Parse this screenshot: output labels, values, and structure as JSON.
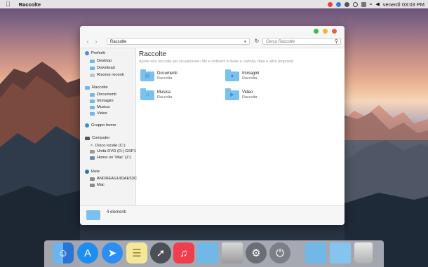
{
  "menubar": {
    "apple": "",
    "app_name": "Raccolte",
    "clock": "venerdì 03:03 PM"
  },
  "window": {
    "address_value": "Raccolte",
    "search_placeholder": "Cerca Raccolte",
    "sidebar": {
      "favorites": {
        "label": "Preferiti",
        "items": [
          "Desktop",
          "Download",
          "Risorse recenti"
        ]
      },
      "libraries": {
        "label": "Raccolte",
        "items": [
          "Documenti",
          "Immagini",
          "Musica",
          "Video"
        ]
      },
      "homegroup": {
        "label": "Gruppo home"
      },
      "computer": {
        "label": "Computer",
        "items": [
          "Disco locale (C:)",
          "Unità DVD (D:) GSP1",
          "Home on 'Mac' (Z:)"
        ]
      },
      "network": {
        "label": "Rete",
        "items": [
          "ANDREAGUIDAE53C",
          "Mac"
        ]
      }
    },
    "main": {
      "title": "Raccolte",
      "subtitle": "Aprire una raccolta per visualizzare i file e ordinarli in base a cartella, data e altre proprietà.",
      "libraries": [
        {
          "name": "Documenti",
          "kind": "Raccolta",
          "icon": "document-icon"
        },
        {
          "name": "Immagini",
          "kind": "Raccolta",
          "icon": "image-icon"
        },
        {
          "name": "Musica",
          "kind": "Raccolta",
          "icon": "music-icon"
        },
        {
          "name": "Video",
          "kind": "Raccolta",
          "icon": "video-icon"
        }
      ]
    },
    "status": {
      "count": "4 elementi"
    }
  },
  "colors": {
    "folder": "#79c1ef",
    "traffic_green": "#2ec43f",
    "traffic_yellow": "#f6b62a",
    "traffic_red": "#f25a4f"
  },
  "dock": {
    "items": [
      "finder-icon",
      "app-store-icon",
      "safari-icon",
      "notes-icon",
      "launchpad-icon",
      "music-icon",
      "folder-icon",
      "drive-icon",
      "settings-icon",
      "power-icon",
      "window-icon",
      "folder-icon",
      "trash-icon"
    ]
  }
}
